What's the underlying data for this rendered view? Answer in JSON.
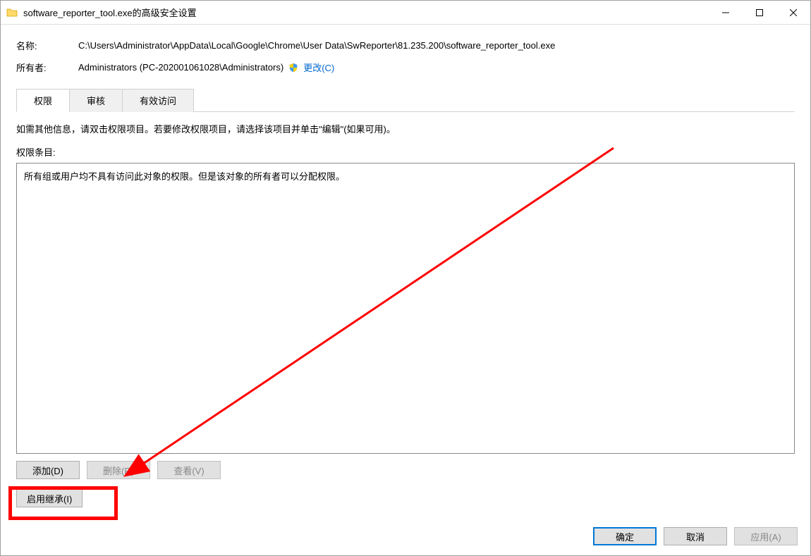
{
  "window": {
    "title": "software_reporter_tool.exe的高级安全设置"
  },
  "fields": {
    "name_label": "名称:",
    "name_value": "C:\\Users\\Administrator\\AppData\\Local\\Google\\Chrome\\User Data\\SwReporter\\81.235.200\\software_reporter_tool.exe",
    "owner_label": "所有者:",
    "owner_value": "Administrators (PC-202001061028\\Administrators)",
    "change_link": "更改(C)"
  },
  "tabs": {
    "permissions": "权限",
    "auditing": "审核",
    "effective_access": "有效访问"
  },
  "body": {
    "instruction": "如需其他信息，请双击权限项目。若要修改权限项目，请选择该项目并单击\"编辑\"(如果可用)。",
    "entries_label": "权限条目:",
    "entries_message": "所有组或用户均不具有访问此对象的权限。但是该对象的所有者可以分配权限。"
  },
  "buttons": {
    "add": "添加(D)",
    "remove": "删除(R)",
    "view": "查看(V)",
    "enable_inherit": "启用继承(I)",
    "ok": "确定",
    "cancel": "取消",
    "apply": "应用(A)"
  }
}
